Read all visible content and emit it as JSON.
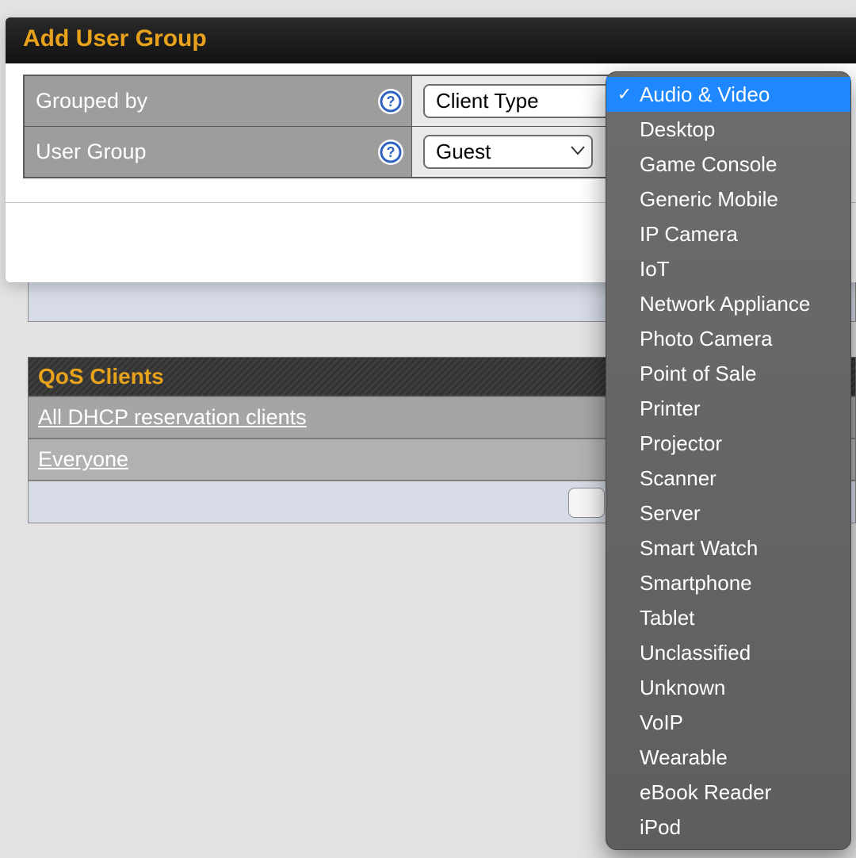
{
  "panel": {
    "title": "Add User Group",
    "rows": {
      "grouped_by": {
        "label": "Grouped by",
        "value": "Client Type"
      },
      "user_group": {
        "label": "User Group",
        "value": "Guest"
      }
    }
  },
  "qos": {
    "title": "QoS Clients",
    "rows": [
      "All DHCP reservation clients",
      "Everyone"
    ]
  },
  "dropdown": {
    "selected_index": 0,
    "items": [
      "Audio & Video",
      "Desktop",
      "Game Console",
      "Generic Mobile",
      "IP Camera",
      "IoT",
      "Network Appliance",
      "Photo Camera",
      "Point of Sale",
      "Printer",
      "Projector",
      "Scanner",
      "Server",
      "Smart Watch",
      "Smartphone",
      "Tablet",
      "Unclassified",
      "Unknown",
      "VoIP",
      "Wearable",
      "eBook Reader",
      "iPod"
    ]
  }
}
